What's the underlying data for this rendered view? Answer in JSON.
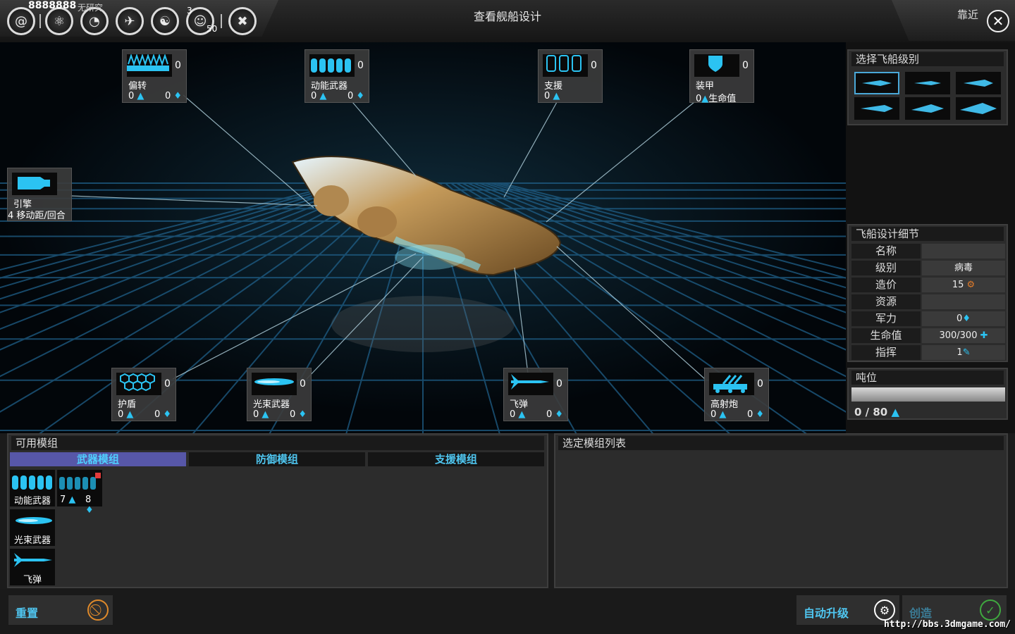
{
  "topbar": {
    "credits": "8888888",
    "credits_sub": "无研究",
    "research_count": "3",
    "research_sub": "50",
    "title": "查看舰船设计",
    "zoom_label": "靠近",
    "close_glyph": "✕"
  },
  "slots": {
    "deflector": {
      "name": "偏转",
      "count": "0",
      "stat_a": "0",
      "stat_b": "0"
    },
    "kinetic": {
      "name": "动能武器",
      "count": "0",
      "stat_a": "0",
      "stat_b": "0"
    },
    "support": {
      "name": "支援",
      "count": "0",
      "stat_a": "0"
    },
    "armor": {
      "name": "装甲",
      "count": "0",
      "stat_a": "0",
      "stat_a_suffix": "生命值"
    },
    "engine": {
      "name": "引擎",
      "stat_a": "4 移动距/回合"
    },
    "shield": {
      "name": "护盾",
      "count": "0",
      "stat_a": "0",
      "stat_b": "0"
    },
    "beam": {
      "name": "光束武器",
      "count": "0",
      "stat_a": "0",
      "stat_b": "0"
    },
    "missile": {
      "name": "飞弹",
      "count": "0",
      "stat_a": "0",
      "stat_b": "0"
    },
    "flak": {
      "name": "高射炮",
      "count": "0",
      "stat_a": "0",
      "stat_b": "0"
    }
  },
  "ship_class": {
    "title": "选择飞船级别",
    "selected_index": 0
  },
  "design_details": {
    "title": "飞船设计细节",
    "rows": [
      {
        "key": "名称",
        "value": ""
      },
      {
        "key": "级别",
        "value": "病毒"
      },
      {
        "key": "造价",
        "value": "15"
      },
      {
        "key": "资源",
        "value": ""
      },
      {
        "key": "军力",
        "value": "0"
      },
      {
        "key": "生命值",
        "value": "300/300"
      },
      {
        "key": "指挥",
        "value": "1"
      }
    ]
  },
  "tonnage": {
    "title": "吨位",
    "value": "0 / 80",
    "fill": 0
  },
  "available_modules": {
    "title": "可用模组",
    "tabs": [
      "武器模组",
      "防御模组",
      "支援模组"
    ],
    "active_tab": 0,
    "items": [
      {
        "label": "动能武器"
      },
      {
        "stat_a": "7",
        "stat_b": "8"
      },
      {
        "label": "光束武器"
      },
      {
        "label": "飞弹"
      }
    ]
  },
  "selected_modules": {
    "title": "选定模组列表"
  },
  "footer": {
    "reset": "重置",
    "auto_upgrade": "自动升级",
    "create": "创造"
  },
  "watermark": "http://bbs.3dmgame.com/",
  "colors": {
    "accent": "#4fc6f0",
    "tab_active": "#5757a8",
    "panel": "#2c2c2c"
  }
}
